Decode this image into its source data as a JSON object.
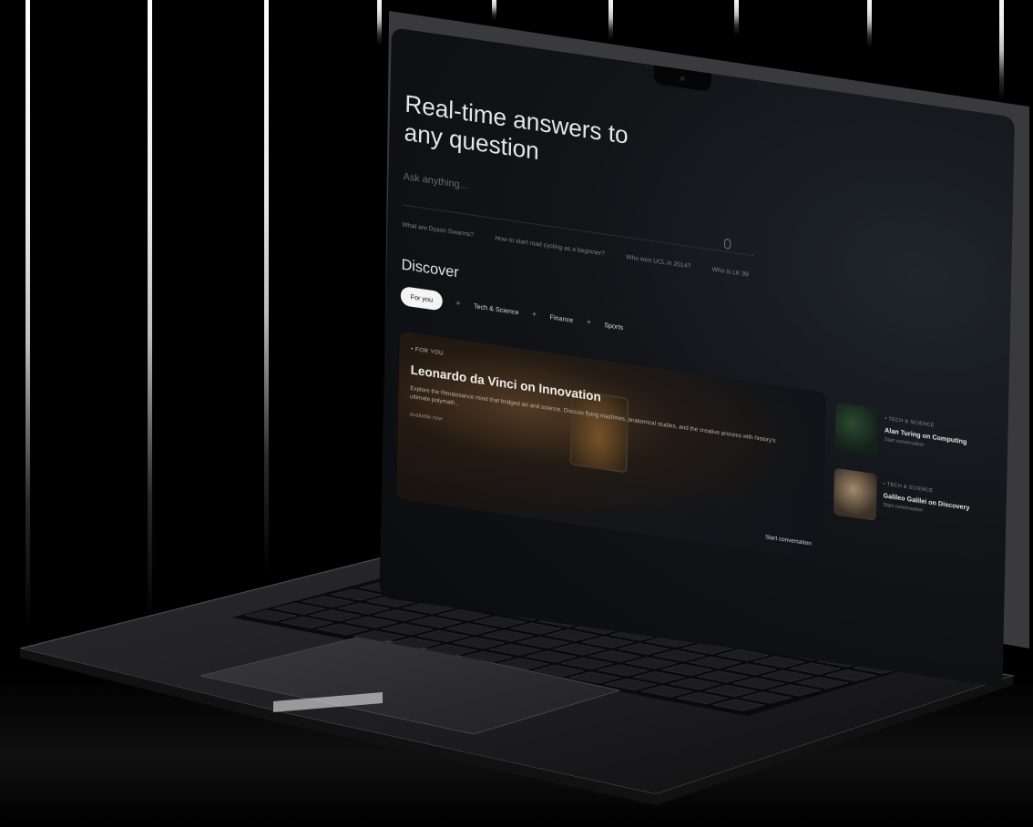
{
  "hero": {
    "title": "Real-time answers to any question"
  },
  "search": {
    "placeholder": "Ask anything..."
  },
  "suggestions": [
    "What are Dyson Swarms?",
    "How to start road cycling as a beginner?",
    "Who won UCL in 2014?",
    "Who is LK 99"
  ],
  "discover": {
    "heading": "Discover",
    "tabs": [
      "For you",
      "Tech & Science",
      "Finance",
      "Sports"
    ]
  },
  "feature": {
    "eyebrow": "• FOR YOU",
    "title": "Leonardo da Vinci on Innovation",
    "description": "Explore the Renaissance mind that bridged art and science. Discuss flying machines, anatomical studies, and the creative process with history's ultimate polymath...",
    "availability": "Available now",
    "cta": "Start conversation"
  },
  "side_cards": [
    {
      "eyebrow": "• TECH & SCIENCE",
      "title": "Alan Turing on Computing",
      "cta": "Start conversation"
    },
    {
      "eyebrow": "• TECH & SCIENCE",
      "title": "Galileo Galilei on Discovery",
      "cta": "Start conversation"
    }
  ],
  "icons": {
    "mic": "microphone-icon",
    "plus": "plus-icon"
  }
}
